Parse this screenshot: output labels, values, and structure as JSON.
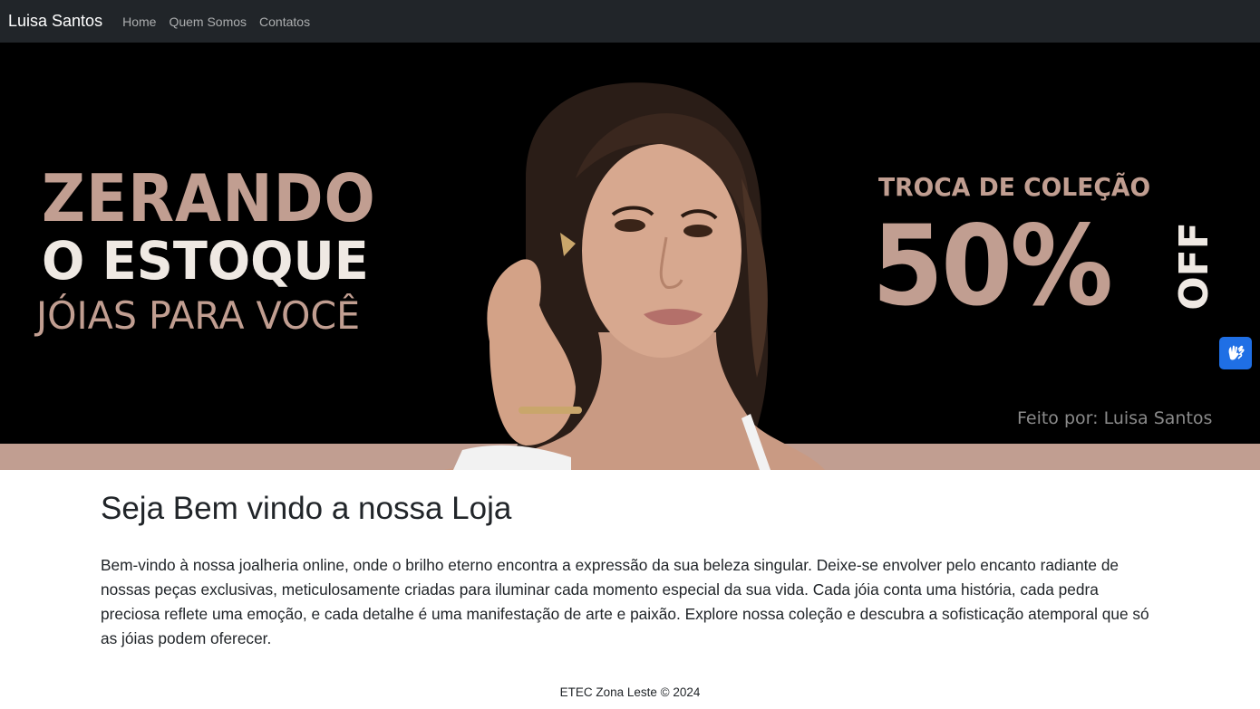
{
  "navbar": {
    "brand": "Luisa Santos",
    "links": [
      "Home",
      "Quem Somos",
      "Contatos"
    ]
  },
  "banner": {
    "headline_line1": "ZERANDO",
    "headline_line2": "O ESTOQUE",
    "tagline": "JÓIAS PARA VOCÊ",
    "promo_title": "TROCA DE COLEÇÃO",
    "promo_value": "50%",
    "promo_suffix": "OFF",
    "credit": "Feito por: Luisa Santos",
    "colors": {
      "accent": "#c19e91",
      "light": "#efe9e3",
      "background": "#000000"
    }
  },
  "accessibility": {
    "icon": "sign-language-hands-icon"
  },
  "main": {
    "title": "Seja Bem vindo a nossa Loja",
    "text": "Bem-vindo à nossa joalheria online, onde o brilho eterno encontra a expressão da sua beleza singular. Deixe-se envolver pelo encanto radiante de nossas peças exclusivas, meticulosamente criadas para iluminar cada momento especial da sua vida. Cada jóia conta uma história, cada pedra preciosa reflete uma emoção, e cada detalhe é uma manifestação de arte e paixão. Explore nossa coleção e descubra a sofisticação atemporal que só as jóias podem oferecer."
  },
  "footer": {
    "text": "ETEC Zona Leste © 2024"
  }
}
